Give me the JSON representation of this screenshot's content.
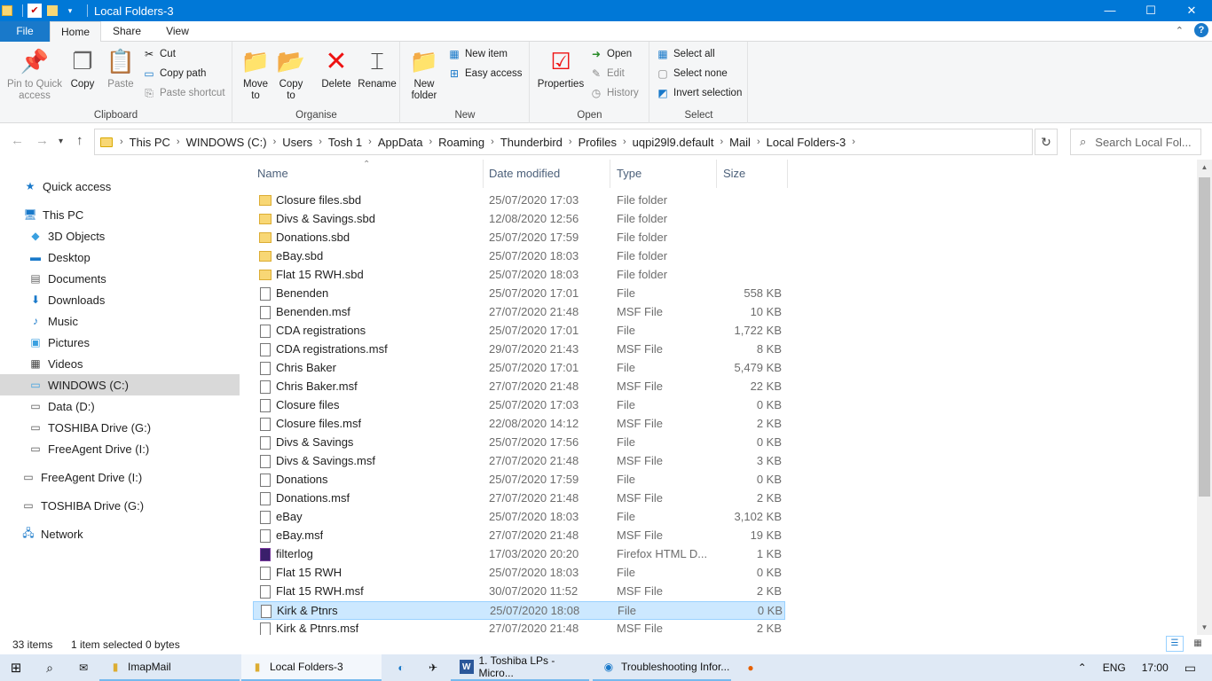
{
  "window": {
    "title": "Local Folders-3",
    "controls": {
      "minimize": "—",
      "maximize": "☐",
      "close": "✕"
    }
  },
  "ribbon_tabs": {
    "file": "File",
    "home": "Home",
    "share": "Share",
    "view": "View"
  },
  "ribbon": {
    "clipboard": {
      "label": "Clipboard",
      "pin": "Pin to Quick access",
      "copy": "Copy",
      "paste": "Paste",
      "cut": "Cut",
      "copy_path": "Copy path",
      "paste_shortcut": "Paste shortcut"
    },
    "organise": {
      "label": "Organise",
      "move_to": "Move to",
      "copy_to": "Copy to",
      "delete": "Delete",
      "rename": "Rename"
    },
    "new": {
      "label": "New",
      "new_folder": "New folder",
      "new_item": "New item",
      "easy_access": "Easy access"
    },
    "open": {
      "label": "Open",
      "properties": "Properties",
      "open": "Open",
      "edit": "Edit",
      "history": "History"
    },
    "select": {
      "label": "Select",
      "select_all": "Select all",
      "select_none": "Select none",
      "invert_selection": "Invert selection"
    }
  },
  "address": {
    "crumbs": [
      "This PC",
      "WINDOWS (C:)",
      "Users",
      "Tosh 1",
      "AppData",
      "Roaming",
      "Thunderbird",
      "Profiles",
      "uqpi29l9.default",
      "Mail",
      "Local Folders-3"
    ],
    "search_placeholder": "Search Local Fol..."
  },
  "nav": {
    "quick_access": "Quick access",
    "this_pc": "This PC",
    "objects_3d": "3D Objects",
    "desktop": "Desktop",
    "documents": "Documents",
    "downloads": "Downloads",
    "music": "Music",
    "pictures": "Pictures",
    "videos": "Videos",
    "windows_c": "WINDOWS (C:)",
    "data_d": "Data (D:)",
    "toshiba_g_sub": "TOSHIBA Drive (G:)",
    "freeagent_i_sub": "FreeAgent Drive (I:)",
    "freeagent_i": "FreeAgent Drive (I:)",
    "toshiba_g": "TOSHIBA Drive (G:)",
    "network": "Network"
  },
  "columns": {
    "name": "Name",
    "date": "Date modified",
    "type": "Type",
    "size": "Size"
  },
  "files": [
    {
      "name": "Closure files.sbd",
      "date": "25/07/2020 17:03",
      "type": "File folder",
      "size": "",
      "kind": "folder"
    },
    {
      "name": "Divs & Savings.sbd",
      "date": "12/08/2020 12:56",
      "type": "File folder",
      "size": "",
      "kind": "folder"
    },
    {
      "name": "Donations.sbd",
      "date": "25/07/2020 17:59",
      "type": "File folder",
      "size": "",
      "kind": "folder"
    },
    {
      "name": "eBay.sbd",
      "date": "25/07/2020 18:03",
      "type": "File folder",
      "size": "",
      "kind": "folder"
    },
    {
      "name": "Flat 15 RWH.sbd",
      "date": "25/07/2020 18:03",
      "type": "File folder",
      "size": "",
      "kind": "folder"
    },
    {
      "name": "Benenden",
      "date": "25/07/2020 17:01",
      "type": "File",
      "size": "558 KB",
      "kind": "file"
    },
    {
      "name": "Benenden.msf",
      "date": "27/07/2020 21:48",
      "type": "MSF File",
      "size": "10 KB",
      "kind": "file"
    },
    {
      "name": "CDA registrations",
      "date": "25/07/2020 17:01",
      "type": "File",
      "size": "1,722 KB",
      "kind": "file"
    },
    {
      "name": "CDA registrations.msf",
      "date": "29/07/2020 21:43",
      "type": "MSF File",
      "size": "8 KB",
      "kind": "file"
    },
    {
      "name": "Chris Baker",
      "date": "25/07/2020 17:01",
      "type": "File",
      "size": "5,479 KB",
      "kind": "file"
    },
    {
      "name": "Chris Baker.msf",
      "date": "27/07/2020 21:48",
      "type": "MSF File",
      "size": "22 KB",
      "kind": "file"
    },
    {
      "name": "Closure files",
      "date": "25/07/2020 17:03",
      "type": "File",
      "size": "0 KB",
      "kind": "file"
    },
    {
      "name": "Closure files.msf",
      "date": "22/08/2020 14:12",
      "type": "MSF File",
      "size": "2 KB",
      "kind": "file"
    },
    {
      "name": "Divs & Savings",
      "date": "25/07/2020 17:56",
      "type": "File",
      "size": "0 KB",
      "kind": "file"
    },
    {
      "name": "Divs & Savings.msf",
      "date": "27/07/2020 21:48",
      "type": "MSF File",
      "size": "3 KB",
      "kind": "file"
    },
    {
      "name": "Donations",
      "date": "25/07/2020 17:59",
      "type": "File",
      "size": "0 KB",
      "kind": "file"
    },
    {
      "name": "Donations.msf",
      "date": "27/07/2020 21:48",
      "type": "MSF File",
      "size": "2 KB",
      "kind": "file"
    },
    {
      "name": "eBay",
      "date": "25/07/2020 18:03",
      "type": "File",
      "size": "3,102 KB",
      "kind": "file"
    },
    {
      "name": "eBay.msf",
      "date": "27/07/2020 21:48",
      "type": "MSF File",
      "size": "19 KB",
      "kind": "file"
    },
    {
      "name": "filterlog",
      "date": "17/03/2020 20:20",
      "type": "Firefox HTML D...",
      "size": "1 KB",
      "kind": "html"
    },
    {
      "name": "Flat 15 RWH",
      "date": "25/07/2020 18:03",
      "type": "File",
      "size": "0 KB",
      "kind": "file"
    },
    {
      "name": "Flat 15 RWH.msf",
      "date": "30/07/2020 11:52",
      "type": "MSF File",
      "size": "2 KB",
      "kind": "file"
    },
    {
      "name": "Kirk & Ptnrs",
      "date": "25/07/2020 18:08",
      "type": "File",
      "size": "0 KB",
      "kind": "file",
      "selected": true
    },
    {
      "name": "Kirk & Ptnrs.msf",
      "date": "27/07/2020 21:48",
      "type": "MSF File",
      "size": "2 KB",
      "kind": "file"
    }
  ],
  "status": {
    "count": "33 items",
    "selection": "1 item selected  0 bytes"
  },
  "taskbar": {
    "imapmail": "ImapMail",
    "local_folders": "Local Folders-3",
    "word": "1. Toshiba LPs - Micro...",
    "troubleshooting": "Troubleshooting Infor...",
    "lang": "ENG",
    "time": "17:00"
  }
}
